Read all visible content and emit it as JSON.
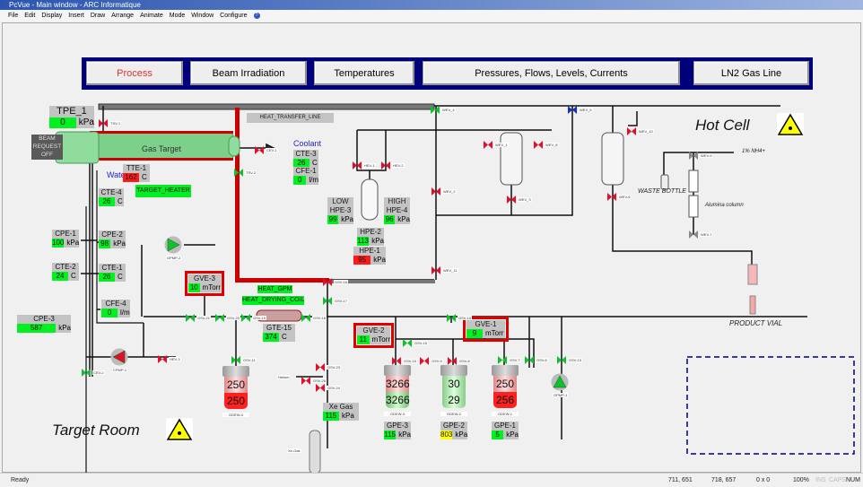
{
  "window": {
    "title": "PcVue - Main window - ARC Informatique"
  },
  "menu": [
    "File",
    "Edit",
    "Display",
    "Insert",
    "Draw",
    "Arrange",
    "Animate",
    "Mode",
    "Window",
    "Configure"
  ],
  "nav": [
    {
      "label": "Process",
      "active": true
    },
    {
      "label": "Beam Irradiation"
    },
    {
      "label": "Temperatures"
    },
    {
      "label": "Pressures, Flows, Levels, Currents"
    },
    {
      "label": "LN2 Gas Line"
    }
  ],
  "areas": {
    "hot_cell": "Hot Cell",
    "target_room": "Target Room"
  },
  "labels": {
    "heat_transfer_line": "HEAT_TRANSFER_LINE",
    "gas_target": "Gas Target",
    "coolant": "Coolant",
    "water": "Water",
    "beam_request": "BEAM REQUEST OFF",
    "target_heater": "TARGET_HEATER",
    "heat_gpm": "HEAT_GPM",
    "heat_drying_coil": "HEAT_DRYING_COIL",
    "waste_bottle": "WASTE BOTTLE",
    "alumina_column": "Alumina column",
    "nh4": "1% NH4+",
    "product_vial": "PRODUCT VIAL",
    "helium": "Helium",
    "xe_gas": "Xe-Gas",
    "low": "LOW",
    "high": "HIGH"
  },
  "gauges": [
    {
      "id": "TPE_1",
      "label": "TPE_1",
      "value": "0",
      "unit": "kPa",
      "status": "green"
    },
    {
      "id": "TTE-1",
      "label": "TTE-1",
      "value": "162",
      "unit": "C",
      "status": "red"
    },
    {
      "id": "CTE-3",
      "label": "CTE-3",
      "value": "26",
      "unit": "C",
      "status": "green"
    },
    {
      "id": "CFE-1",
      "label": "CFE-1",
      "value": "0",
      "unit": "l/m",
      "status": "green"
    },
    {
      "id": "CTE-4",
      "label": "CTE-4",
      "value": "26",
      "unit": "C",
      "status": "green"
    },
    {
      "id": "CPE-1",
      "label": "CPE-1",
      "value": "100",
      "unit": "kPa",
      "status": "green"
    },
    {
      "id": "CPE-2",
      "label": "CPE-2",
      "value": "98",
      "unit": "kPa",
      "status": "green"
    },
    {
      "id": "CTE-2",
      "label": "CTE-2",
      "value": "24",
      "unit": "C",
      "status": "green"
    },
    {
      "id": "CTE-1",
      "label": "CTE-1",
      "value": "26",
      "unit": "C",
      "status": "green"
    },
    {
      "id": "CFE-4",
      "label": "CFE-4",
      "value": "0",
      "unit": "l/m",
      "status": "green"
    },
    {
      "id": "CPE-3",
      "label": "CPE-3",
      "value": "587",
      "unit": "kPa",
      "status": "green"
    },
    {
      "id": "GVE-3",
      "label": "GVE-3",
      "value": "10",
      "unit": "mTorr",
      "status": "green",
      "alarm": true
    },
    {
      "id": "GTE-15",
      "label": "GTE-15",
      "value": "374",
      "unit": "C",
      "status": "green"
    },
    {
      "id": "HPE-3",
      "label": "HPE-3",
      "value": "99",
      "unit": "kPa",
      "status": "green"
    },
    {
      "id": "HPE-4",
      "label": "HPE-4",
      "value": "96",
      "unit": "kPa",
      "status": "green"
    },
    {
      "id": "HPE-2",
      "label": "HPE-2",
      "value": "113",
      "unit": "kPa",
      "status": "green"
    },
    {
      "id": "HPE-1",
      "label": "HPE-1",
      "value": "95",
      "unit": "kPa",
      "status": "red"
    },
    {
      "id": "GVE-2",
      "label": "GVE-2",
      "value": "11",
      "unit": "mTorr",
      "status": "green",
      "alarm": true
    },
    {
      "id": "GVE-1",
      "label": "GVE-1",
      "value": "9",
      "unit": "mTorr",
      "status": "green",
      "alarm": true
    },
    {
      "id": "XE",
      "label": "Xe Gas Pres",
      "value": "115",
      "unit": "kPa",
      "status": "green"
    },
    {
      "id": "GPE-3",
      "label": "GPE-3",
      "value": "115",
      "unit": "kPa",
      "status": "green"
    },
    {
      "id": "GPE-2",
      "label": "GPE-2",
      "value": "803",
      "unit": "kPa",
      "status": "yellow"
    },
    {
      "id": "GPE-1",
      "label": "GPE-1",
      "value": "5",
      "unit": "kPa",
      "status": "green"
    }
  ],
  "tanks": [
    {
      "tag": "GDEW-4",
      "top": "250",
      "bottom": "250",
      "color": "red"
    },
    {
      "tag": "GDEW-3",
      "top": "3266",
      "bottom": "3266",
      "color": "redgreen"
    },
    {
      "tag": "GDEW-2",
      "top": "30",
      "bottom": "29",
      "color": "green"
    },
    {
      "tag": "GDEW-1",
      "top": "250",
      "bottom": "256",
      "color": "red"
    }
  ],
  "valves": [
    {
      "tag": "TSV-1",
      "state": "red"
    },
    {
      "tag": "TSV-2",
      "state": "green"
    },
    {
      "tag": "CEV-1",
      "state": "red"
    },
    {
      "tag": "CEV-2",
      "state": "green"
    },
    {
      "tag": "HEV-3",
      "state": "red"
    },
    {
      "tag": "HEV-1",
      "state": "red"
    },
    {
      "tag": "HEV-2",
      "state": "red"
    },
    {
      "tag": "WEV_1",
      "state": "red"
    },
    {
      "tag": "WEV_2",
      "state": "red"
    },
    {
      "tag": "WEV_3",
      "state": "red"
    },
    {
      "tag": "WEV_4",
      "state": "green"
    },
    {
      "tag": "WEV_5",
      "state": "blue"
    },
    {
      "tag": "WEV-6",
      "state": "red"
    },
    {
      "tag": "WEV_8",
      "state": "red"
    },
    {
      "tag": "WEV_10",
      "state": "red"
    },
    {
      "tag": "WEV_11",
      "state": "red"
    },
    {
      "tag": "WEV-9",
      "state": "gray"
    },
    {
      "tag": "WEV-7",
      "state": "gray"
    },
    {
      "tag": "GSV-16",
      "state": "red"
    },
    {
      "tag": "GSV-17",
      "state": "green"
    },
    {
      "tag": "GSV-21",
      "state": "green"
    },
    {
      "tag": "GSV-20",
      "state": "green"
    },
    {
      "tag": "GSV-19",
      "state": "green"
    },
    {
      "tag": "GSV-18",
      "state": "green"
    },
    {
      "tag": "GSV-11",
      "state": "green"
    },
    {
      "tag": "GSV-23",
      "state": "red"
    },
    {
      "tag": "GSV-24",
      "state": "red"
    },
    {
      "tag": "GSV-25",
      "state": "red"
    },
    {
      "tag": "GSV-15",
      "state": "green"
    },
    {
      "tag": "GSV-10",
      "state": "red"
    },
    {
      "tag": "GSV-9",
      "state": "red"
    },
    {
      "tag": "GSV-8",
      "state": "red"
    },
    {
      "tag": "GSV-7",
      "state": "green"
    },
    {
      "tag": "GSV-6",
      "state": "green"
    },
    {
      "tag": "GSV-13",
      "state": "green"
    },
    {
      "tag": "GSV-14",
      "state": "green"
    }
  ],
  "pumps": [
    {
      "tag": "CPMP-1",
      "state": "red"
    },
    {
      "tag": "GPMP-2",
      "state": "green"
    },
    {
      "tag": "GPMP-1",
      "state": "green"
    }
  ],
  "status": {
    "text": "Ready",
    "cursor": "711, 651",
    "selection": "718, 657",
    "size": "0 x  0",
    "zoom": "100%",
    "ins": "INS",
    "caps": "CAPS",
    "num": "NUM"
  },
  "colors": {
    "ok": "#00f020",
    "alarm": "#ff1a1a",
    "warn": "#ffff00",
    "nav_bg": "#00007a",
    "active_nav": "#e0302a"
  }
}
